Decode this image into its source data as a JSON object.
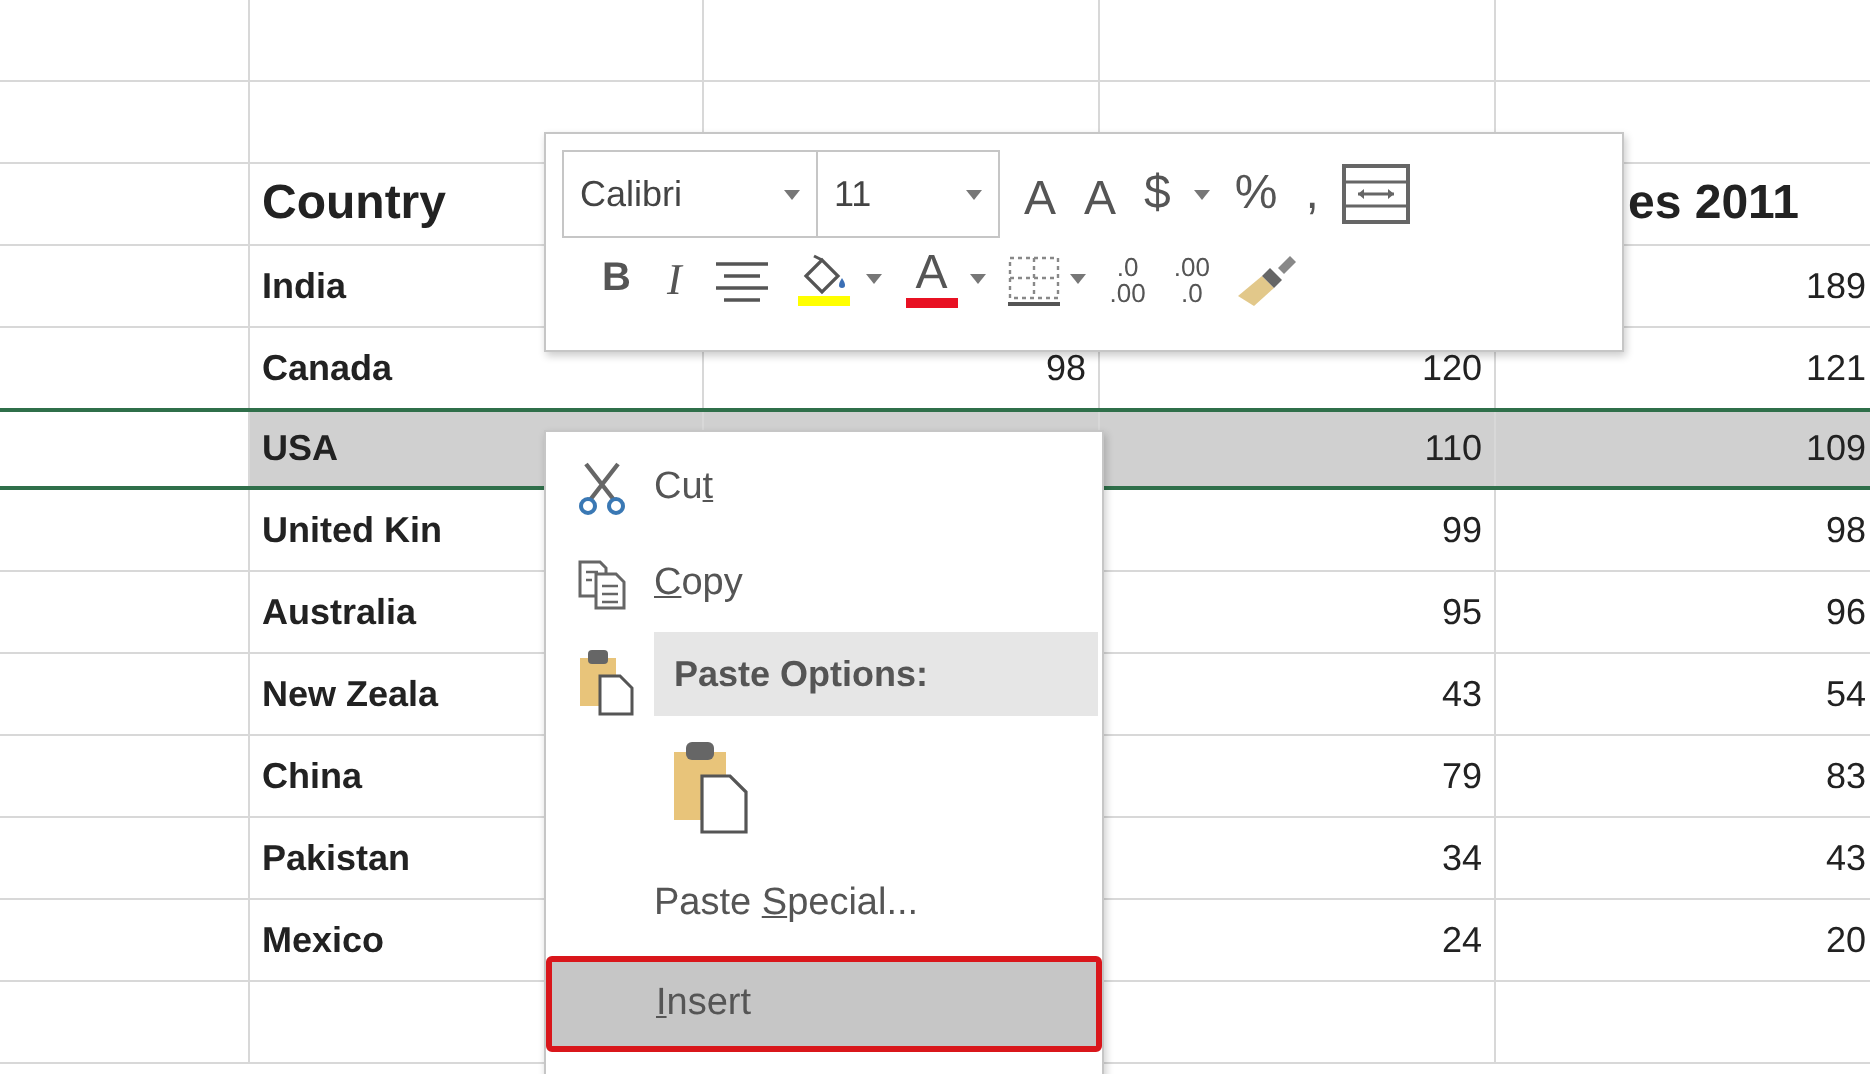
{
  "table": {
    "rows": [
      {
        "kind": "header",
        "country": "Country",
        "column_5": "es 2011",
        "selected": false
      },
      {
        "kind": "data",
        "country": "India",
        "column_5": "189",
        "selected": false
      },
      {
        "kind": "data",
        "country": "Canada",
        "column_3": "98",
        "column_4": "120",
        "column_5": "121",
        "selected": false
      },
      {
        "kind": "data",
        "country": "USA",
        "column_4": "110",
        "column_5": "109",
        "selected": true
      },
      {
        "kind": "data",
        "country": "United Kin",
        "column_4": "99",
        "column_5": "98",
        "selected": false
      },
      {
        "kind": "data",
        "country": "Australia",
        "column_4": "95",
        "column_5": "96",
        "selected": false
      },
      {
        "kind": "data",
        "country": "New Zeala",
        "column_4": "43",
        "column_5": "54",
        "selected": false
      },
      {
        "kind": "data",
        "country": "China",
        "column_4": "79",
        "column_5": "83",
        "selected": false
      },
      {
        "kind": "data",
        "country": "Pakistan",
        "column_4": "34",
        "column_5": "43",
        "selected": false
      },
      {
        "kind": "data",
        "country": "Mexico",
        "column_4": "24",
        "column_5": "20",
        "selected": false
      }
    ]
  },
  "mini_toolbar": {
    "row_1": [
      {
        "kind": "font-field",
        "value": "Calibri"
      },
      {
        "kind": "size-field",
        "value": "11"
      },
      {
        "kind": "grow",
        "label": "A"
      },
      {
        "kind": "shrink",
        "label": "A"
      },
      {
        "kind": "currency",
        "label": "$"
      },
      {
        "kind": "text",
        "label": "%"
      },
      {
        "kind": "text",
        "label": ","
      },
      {
        "kind": "wrap"
      }
    ],
    "row_2": [
      {
        "kind": "bold",
        "label": "B"
      },
      {
        "kind": "italic",
        "label": "I"
      },
      {
        "kind": "align"
      },
      {
        "kind": "fill-color",
        "color": "#ffff00"
      },
      {
        "kind": "font-color",
        "label": "A",
        "color": "#e81123"
      },
      {
        "kind": "borders"
      },
      {
        "kind": "decimal-up",
        "top": ".0",
        "bottom": ".00"
      },
      {
        "kind": "decimal-down",
        "top": ".00",
        "bottom": ".0"
      },
      {
        "kind": "painter"
      }
    ]
  },
  "context_menu": {
    "items": [
      {
        "kind": "cut",
        "text_before": "Cu",
        "underlined": "t",
        "selected": false
      },
      {
        "kind": "copy",
        "underlined": "C",
        "text_after": "opy",
        "selected": false
      },
      {
        "kind": "header",
        "label": "Paste Options:"
      },
      {
        "kind": "paste-option"
      },
      {
        "kind": "command",
        "text_before": "Paste ",
        "underlined": "S",
        "text_after": "pecial...",
        "selected": false
      },
      {
        "kind": "command",
        "underlined": "I",
        "text_after": "nsert",
        "selected": true
      }
    ]
  }
}
